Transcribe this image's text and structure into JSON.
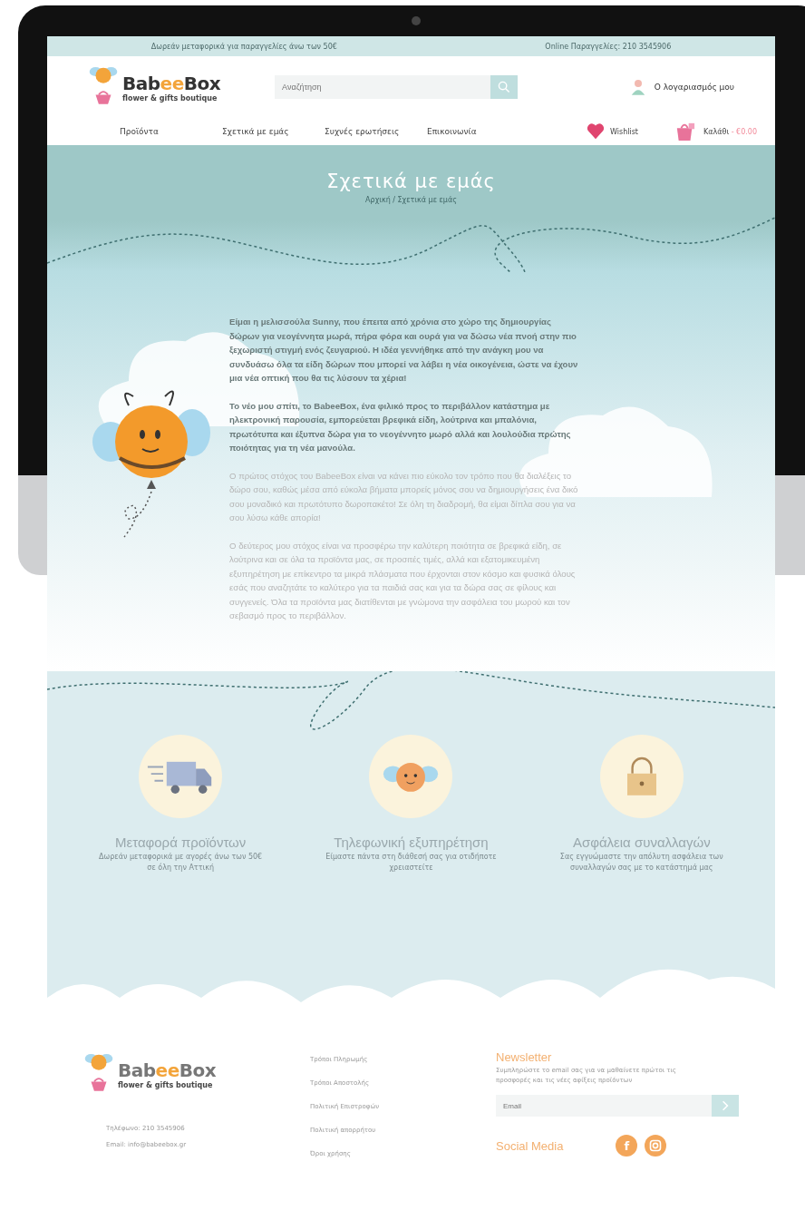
{
  "top_bar": {
    "promo": "Δωρεάν μεταφορικά για παραγγελίες άνω των 50€",
    "phone": "Online Παραγγελίες: 210 3545906"
  },
  "logo": {
    "wordmark": [
      {
        "text": "Bab",
        "accent": false
      },
      {
        "text": "ee",
        "accent": true
      },
      {
        "text": "Box",
        "accent": false
      }
    ],
    "tagline": "flower & gifts boutique"
  },
  "search": {
    "placeholder": "Αναζήτηση"
  },
  "account": {
    "label": "Ο λογαριασμός μου"
  },
  "nav": [
    {
      "label": "Προϊόντα"
    },
    {
      "label": "Σχετικά με εμάς"
    },
    {
      "label": "Συχνές ερωτήσεις"
    },
    {
      "label": "Επικοινωνία"
    }
  ],
  "wishlist": {
    "label": "Wishlist"
  },
  "cart": {
    "label": "Καλάθι",
    "amount": "- €0.00"
  },
  "hero": {
    "title": "Σχετικά με εμάς",
    "breadcrumb": "Αρχική / Σχετικά με εμάς"
  },
  "about": [
    {
      "strong": true,
      "text": "Είμαι η μελισσούλα Sunny, που έπειτα από χρόνια στο χώρο της δημιουργίας δώρων για νεογέννητα μωρά, πήρα φόρα και ουρά για να δώσω νέα πνοή στην πιο ξεχωριστή στιγμή ενός ζευγαριού. Η ιδέα γεννήθηκε από την ανάγκη μου να συνδυάσω όλα τα είδη δώρων που μπορεί να λάβει η νέα οικογένεια, ώστε να έχουν μια νέα οπτική που θα τις λύσουν τα χέρια!"
    },
    {
      "strong": true,
      "text": "Το νέο μου σπίτι, το BabeeBox, ένα φιλικό προς το περιβάλλον κατάστημα με ηλεκτρονική παρουσία, εμπορεύεται βρεφικά είδη, λούτρινα και μπαλόνια, πρωτότυπα και έξυπνα δώρα για το νεογέννητο μωρό αλλά και λουλούδια πρώτης ποιότητας για τη νέα μανούλα."
    },
    {
      "strong": false,
      "text": "Ο πρώτος στόχος του BabeeBox είναι να κάνει πιο εύκολο τον τρόπο που θα διαλέξεις το δώρο σου, καθώς μέσα από εύκολα βήματα μπορείς μόνος σου να δημιουργήσεις ένα δικό σου μοναδικό και πρωτότυπο δωροπακέτο! Σε όλη τη διαδρομή, θα είμαι δίπλα σου για να σου λύσω κάθε απορία!"
    },
    {
      "strong": false,
      "text": "Ο δεύτερος μου στόχος είναι να προσφέρω την καλύτερη ποιότητα σε βρεφικά είδη, σε λούτρινα και σε όλα τα προϊόντα μας, σε προσιτές τιμές, αλλά και εξατομικευμένη εξυπηρέτηση με επίκεντρο τα μικρά πλάσματα που έρχονται στον κόσμο και φυσικά όλους εσάς που αναζητάτε το καλύτερο για τα παιδιά σας και για τα δώρα σας σε φίλους και συγγενείς. Όλα τα προϊόντα μας διατίθενται με γνώμονα την ασφάλεια του μωρού και τον σεβασμό προς το περιβάλλον."
    }
  ],
  "features": [
    {
      "kind": "truck",
      "title": "Μεταφορά προϊόντων",
      "text": "Δωρεάν μεταφορικά με αγορές άνω των 50€ σε όλη την Αττική"
    },
    {
      "kind": "bee",
      "title": "Τηλεφωνική εξυπηρέτηση",
      "text": "Είμαστε πάντα στη διάθεσή σας για οτιδήποτε χρειαστείτε"
    },
    {
      "kind": "lock",
      "title": "Ασφάλεια συναλλαγών",
      "text": "Σας εγγυώμαστε την απόλυτη ασφάλεια των συναλλαγών σας με το κατάστημά μας"
    }
  ],
  "footer": {
    "logo": {
      "wordmark": [
        {
          "text": "Bab",
          "accent": false
        },
        {
          "text": "ee",
          "accent": true
        },
        {
          "text": "Box",
          "accent": false
        }
      ],
      "tagline": "flower & gifts boutique"
    },
    "phone": "Τηλέφωνο: 210 3545906",
    "email": "Email: info@babeebox.gr",
    "links": [
      "Τρόποι Πληρωμής",
      "Τρόποι Αποστολής",
      "Πολιτική Επιστροφών",
      "Πολιτική απορρήτου",
      "Όροι χρήσης"
    ],
    "newsletter": {
      "title": "Newsletter",
      "text": "Συμπληρώστε το email σας για να μαθαίνετε πρώτοι τις προσφορές και τις νέες αφίξεις προϊόντων",
      "placeholder": "Email"
    },
    "social": {
      "title": "Social Media",
      "networks": [
        {
          "kind": "facebook",
          "glyph": "f"
        },
        {
          "kind": "instagram"
        }
      ]
    }
  }
}
